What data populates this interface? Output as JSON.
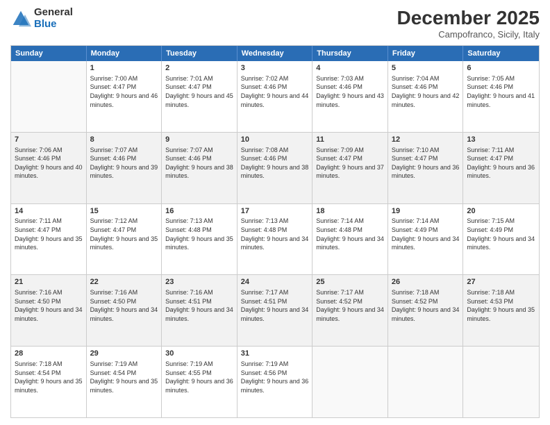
{
  "header": {
    "logo_general": "General",
    "logo_blue": "Blue",
    "month_title": "December 2025",
    "subtitle": "Campofranco, Sicily, Italy"
  },
  "calendar": {
    "days": [
      "Sunday",
      "Monday",
      "Tuesday",
      "Wednesday",
      "Thursday",
      "Friday",
      "Saturday"
    ],
    "rows": [
      [
        {
          "day": "",
          "sunrise": "",
          "sunset": "",
          "daylight": "",
          "empty": true
        },
        {
          "day": "1",
          "sunrise": "Sunrise: 7:00 AM",
          "sunset": "Sunset: 4:47 PM",
          "daylight": "Daylight: 9 hours and 46 minutes.",
          "empty": false
        },
        {
          "day": "2",
          "sunrise": "Sunrise: 7:01 AM",
          "sunset": "Sunset: 4:47 PM",
          "daylight": "Daylight: 9 hours and 45 minutes.",
          "empty": false
        },
        {
          "day": "3",
          "sunrise": "Sunrise: 7:02 AM",
          "sunset": "Sunset: 4:46 PM",
          "daylight": "Daylight: 9 hours and 44 minutes.",
          "empty": false
        },
        {
          "day": "4",
          "sunrise": "Sunrise: 7:03 AM",
          "sunset": "Sunset: 4:46 PM",
          "daylight": "Daylight: 9 hours and 43 minutes.",
          "empty": false
        },
        {
          "day": "5",
          "sunrise": "Sunrise: 7:04 AM",
          "sunset": "Sunset: 4:46 PM",
          "daylight": "Daylight: 9 hours and 42 minutes.",
          "empty": false
        },
        {
          "day": "6",
          "sunrise": "Sunrise: 7:05 AM",
          "sunset": "Sunset: 4:46 PM",
          "daylight": "Daylight: 9 hours and 41 minutes.",
          "empty": false
        }
      ],
      [
        {
          "day": "7",
          "sunrise": "Sunrise: 7:06 AM",
          "sunset": "Sunset: 4:46 PM",
          "daylight": "Daylight: 9 hours and 40 minutes.",
          "empty": false
        },
        {
          "day": "8",
          "sunrise": "Sunrise: 7:07 AM",
          "sunset": "Sunset: 4:46 PM",
          "daylight": "Daylight: 9 hours and 39 minutes.",
          "empty": false
        },
        {
          "day": "9",
          "sunrise": "Sunrise: 7:07 AM",
          "sunset": "Sunset: 4:46 PM",
          "daylight": "Daylight: 9 hours and 38 minutes.",
          "empty": false
        },
        {
          "day": "10",
          "sunrise": "Sunrise: 7:08 AM",
          "sunset": "Sunset: 4:46 PM",
          "daylight": "Daylight: 9 hours and 38 minutes.",
          "empty": false
        },
        {
          "day": "11",
          "sunrise": "Sunrise: 7:09 AM",
          "sunset": "Sunset: 4:47 PM",
          "daylight": "Daylight: 9 hours and 37 minutes.",
          "empty": false
        },
        {
          "day": "12",
          "sunrise": "Sunrise: 7:10 AM",
          "sunset": "Sunset: 4:47 PM",
          "daylight": "Daylight: 9 hours and 36 minutes.",
          "empty": false
        },
        {
          "day": "13",
          "sunrise": "Sunrise: 7:11 AM",
          "sunset": "Sunset: 4:47 PM",
          "daylight": "Daylight: 9 hours and 36 minutes.",
          "empty": false
        }
      ],
      [
        {
          "day": "14",
          "sunrise": "Sunrise: 7:11 AM",
          "sunset": "Sunset: 4:47 PM",
          "daylight": "Daylight: 9 hours and 35 minutes.",
          "empty": false
        },
        {
          "day": "15",
          "sunrise": "Sunrise: 7:12 AM",
          "sunset": "Sunset: 4:47 PM",
          "daylight": "Daylight: 9 hours and 35 minutes.",
          "empty": false
        },
        {
          "day": "16",
          "sunrise": "Sunrise: 7:13 AM",
          "sunset": "Sunset: 4:48 PM",
          "daylight": "Daylight: 9 hours and 35 minutes.",
          "empty": false
        },
        {
          "day": "17",
          "sunrise": "Sunrise: 7:13 AM",
          "sunset": "Sunset: 4:48 PM",
          "daylight": "Daylight: 9 hours and 34 minutes.",
          "empty": false
        },
        {
          "day": "18",
          "sunrise": "Sunrise: 7:14 AM",
          "sunset": "Sunset: 4:48 PM",
          "daylight": "Daylight: 9 hours and 34 minutes.",
          "empty": false
        },
        {
          "day": "19",
          "sunrise": "Sunrise: 7:14 AM",
          "sunset": "Sunset: 4:49 PM",
          "daylight": "Daylight: 9 hours and 34 minutes.",
          "empty": false
        },
        {
          "day": "20",
          "sunrise": "Sunrise: 7:15 AM",
          "sunset": "Sunset: 4:49 PM",
          "daylight": "Daylight: 9 hours and 34 minutes.",
          "empty": false
        }
      ],
      [
        {
          "day": "21",
          "sunrise": "Sunrise: 7:16 AM",
          "sunset": "Sunset: 4:50 PM",
          "daylight": "Daylight: 9 hours and 34 minutes.",
          "empty": false
        },
        {
          "day": "22",
          "sunrise": "Sunrise: 7:16 AM",
          "sunset": "Sunset: 4:50 PM",
          "daylight": "Daylight: 9 hours and 34 minutes.",
          "empty": false
        },
        {
          "day": "23",
          "sunrise": "Sunrise: 7:16 AM",
          "sunset": "Sunset: 4:51 PM",
          "daylight": "Daylight: 9 hours and 34 minutes.",
          "empty": false
        },
        {
          "day": "24",
          "sunrise": "Sunrise: 7:17 AM",
          "sunset": "Sunset: 4:51 PM",
          "daylight": "Daylight: 9 hours and 34 minutes.",
          "empty": false
        },
        {
          "day": "25",
          "sunrise": "Sunrise: 7:17 AM",
          "sunset": "Sunset: 4:52 PM",
          "daylight": "Daylight: 9 hours and 34 minutes.",
          "empty": false
        },
        {
          "day": "26",
          "sunrise": "Sunrise: 7:18 AM",
          "sunset": "Sunset: 4:52 PM",
          "daylight": "Daylight: 9 hours and 34 minutes.",
          "empty": false
        },
        {
          "day": "27",
          "sunrise": "Sunrise: 7:18 AM",
          "sunset": "Sunset: 4:53 PM",
          "daylight": "Daylight: 9 hours and 35 minutes.",
          "empty": false
        }
      ],
      [
        {
          "day": "28",
          "sunrise": "Sunrise: 7:18 AM",
          "sunset": "Sunset: 4:54 PM",
          "daylight": "Daylight: 9 hours and 35 minutes.",
          "empty": false
        },
        {
          "day": "29",
          "sunrise": "Sunrise: 7:19 AM",
          "sunset": "Sunset: 4:54 PM",
          "daylight": "Daylight: 9 hours and 35 minutes.",
          "empty": false
        },
        {
          "day": "30",
          "sunrise": "Sunrise: 7:19 AM",
          "sunset": "Sunset: 4:55 PM",
          "daylight": "Daylight: 9 hours and 36 minutes.",
          "empty": false
        },
        {
          "day": "31",
          "sunrise": "Sunrise: 7:19 AM",
          "sunset": "Sunset: 4:56 PM",
          "daylight": "Daylight: 9 hours and 36 minutes.",
          "empty": false
        },
        {
          "day": "",
          "sunrise": "",
          "sunset": "",
          "daylight": "",
          "empty": true
        },
        {
          "day": "",
          "sunrise": "",
          "sunset": "",
          "daylight": "",
          "empty": true
        },
        {
          "day": "",
          "sunrise": "",
          "sunset": "",
          "daylight": "",
          "empty": true
        }
      ]
    ]
  }
}
